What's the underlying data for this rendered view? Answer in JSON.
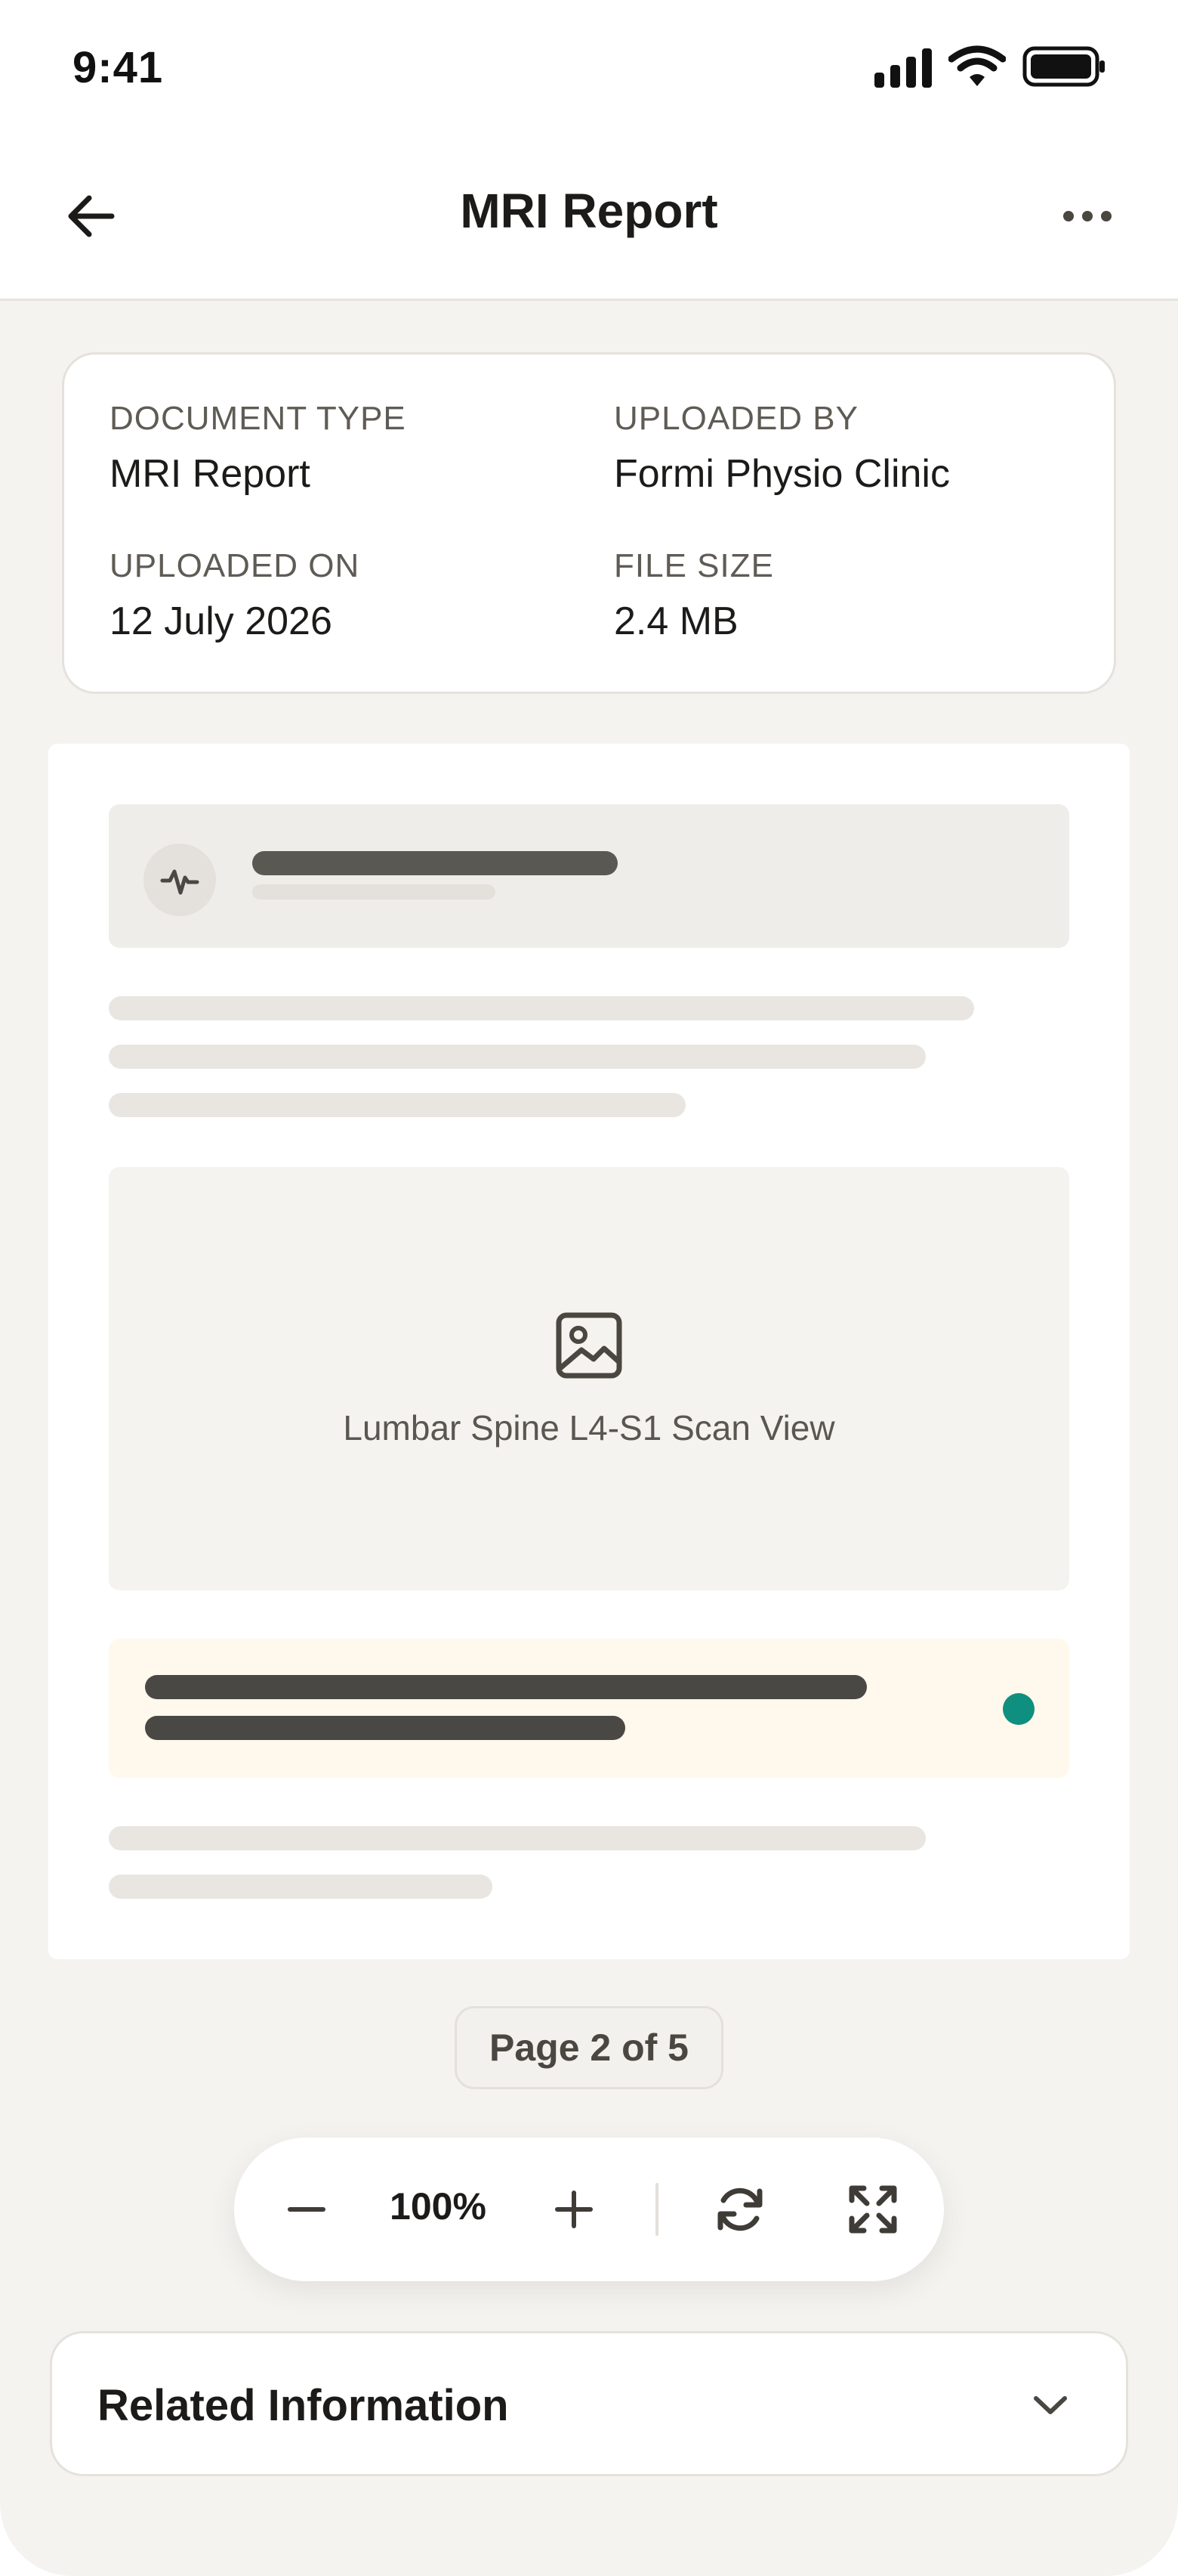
{
  "status_bar": {
    "time": "9:41",
    "icons": [
      "signal-icon",
      "wifi-icon",
      "battery-icon"
    ]
  },
  "header": {
    "title": "MRI Report",
    "back_icon": "arrow-left-icon",
    "more_icon": "more-horizontal-icon"
  },
  "metadata": {
    "document_type_label": "DOCUMENT TYPE",
    "document_type_value": "MRI Report",
    "uploaded_by_label": "UPLOADED BY",
    "uploaded_by_value": "Formi Physio Clinic",
    "uploaded_on_label": "UPLOADED ON",
    "uploaded_on_value": "12 July 2026",
    "file_size_label": "FILE SIZE",
    "file_size_value": "2.4 MB"
  },
  "document_preview": {
    "header_icon": "pulse-icon",
    "image_icon": "image-icon",
    "image_caption": "Lumbar Spine L4-S1 Scan View"
  },
  "pagination": {
    "label": "Page 2 of 5"
  },
  "zoom_toolbar": {
    "zoom_level": "100%",
    "buttons": [
      "zoom-out-icon",
      "zoom-in-icon",
      "rotate-icon",
      "fullscreen-icon"
    ]
  },
  "related": {
    "title": "Related Information",
    "icon": "chevron-down-icon"
  },
  "colors": {
    "background": "#f5f3ef",
    "skeleton_dark": "#4a4845",
    "skeleton_light": "#e9e6e1",
    "highlight_bg": "#fff8ec",
    "accent_teal": "#0f8f7f"
  }
}
